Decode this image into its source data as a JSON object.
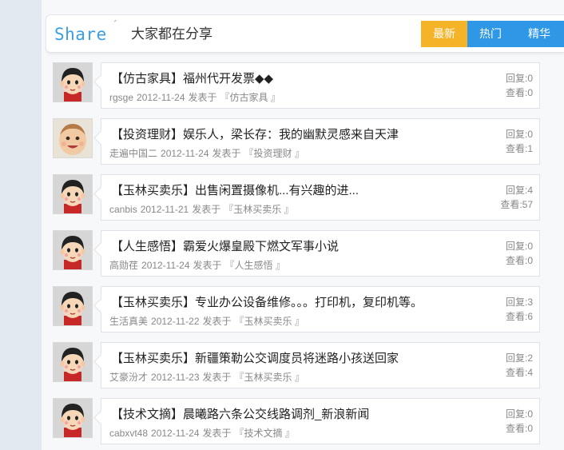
{
  "header": {
    "brand": "Share",
    "brand_mark": "´",
    "subtitle": "大家都在分享",
    "tabs": [
      "最新",
      "热门",
      "精华"
    ]
  },
  "posts": [
    {
      "title": "【仿古家具】福州代开发票◆◆",
      "author": "rgsge",
      "date": "2012-11-24",
      "action": "发表于",
      "category": "『仿古家具 』",
      "replies": "回复:0",
      "views": "查看:0",
      "avatar": "cartoon-boy"
    },
    {
      "title": "【投资理财】娱乐人，梁长存：我的幽默灵感来自天津",
      "author": "走遍中国二",
      "date": "2012-11-24",
      "action": "发表于",
      "category": "『投资理财 』",
      "replies": "回复:0",
      "views": "查看:1",
      "avatar": "baby-photo"
    },
    {
      "title": "【玉林买卖乐】出售闲置摄像机...有兴趣的进...",
      "author": "canbis",
      "date": "2012-11-21",
      "action": "发表于",
      "category": "『玉林买卖乐 』",
      "replies": "回复:4",
      "views": "查看:57",
      "avatar": "cartoon-boy"
    },
    {
      "title": "【人生感悟】霸爱火爆皇殿下燃文军事小说",
      "author": "高勋荏",
      "date": "2012-11-24",
      "action": "发表于",
      "category": "『人生感悟 』",
      "replies": "回复:0",
      "views": "查看:0",
      "avatar": "cartoon-boy"
    },
    {
      "title": "【玉林买卖乐】专业办公设备维修。。。打印机，复印机等。",
      "author": "生活真美",
      "date": "2012-11-22",
      "action": "发表于",
      "category": "『玉林买卖乐 』",
      "replies": "回复:3",
      "views": "查看:6",
      "avatar": "cartoon-boy"
    },
    {
      "title": "【玉林买卖乐】新疆策勒公交调度员将迷路小孩送回家",
      "author": "艾豪汾才",
      "date": "2012-11-23",
      "action": "发表于",
      "category": "『玉林买卖乐 』",
      "replies": "回复:2",
      "views": "查看:4",
      "avatar": "cartoon-boy"
    },
    {
      "title": "【技术文摘】晨曦路六条公交线路调剂_新浪新闻",
      "author": "cabxvt48",
      "date": "2012-11-24",
      "action": "发表于",
      "category": "『技术文摘 』",
      "replies": "回复:0",
      "views": "查看:0",
      "avatar": "cartoon-boy"
    }
  ],
  "colors": {
    "accent_blue": "#2e97e6",
    "accent_orange": "#f5b327",
    "brand_blue": "#3a9ee4"
  }
}
